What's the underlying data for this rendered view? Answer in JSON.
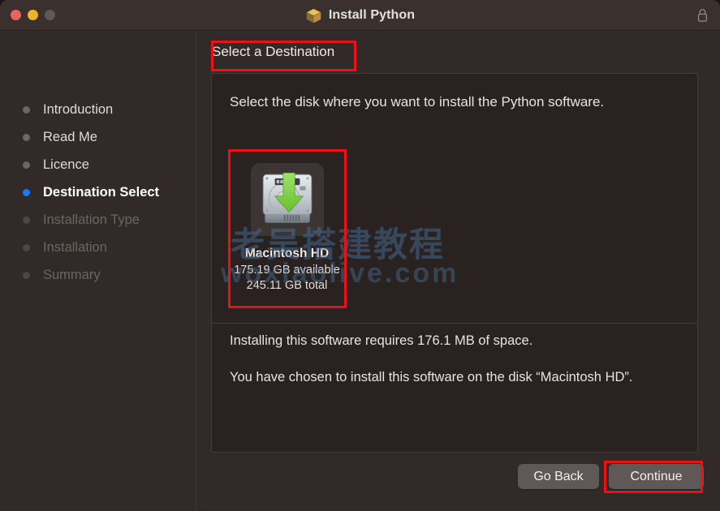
{
  "window": {
    "title": "Install Python",
    "package_icon": "package-box-icon",
    "lock_icon": "lock-icon",
    "traffic_lights": {
      "close": "close-button",
      "minimize": "minimize-button",
      "zoom": "zoom-button"
    },
    "colors": {
      "window_background": "#322A28",
      "titlebar_background": "#3A312E",
      "panel_background": "#2A2220",
      "accent_current_step": "#157DFB",
      "annotation_red": "#EE1111",
      "button_background": "#605856"
    }
  },
  "sidebar": {
    "items": [
      {
        "label": "Introduction",
        "state": "done"
      },
      {
        "label": "Read Me",
        "state": "done"
      },
      {
        "label": "Licence",
        "state": "done"
      },
      {
        "label": "Destination Select",
        "state": "current"
      },
      {
        "label": "Installation Type",
        "state": "future"
      },
      {
        "label": "Installation",
        "state": "future"
      },
      {
        "label": "Summary",
        "state": "future"
      }
    ]
  },
  "main": {
    "heading": "Select a Destination",
    "instruction": "Select the disk where you want to install the Python software.",
    "disks": [
      {
        "name": "Macintosh HD",
        "available": "175.19 GB available",
        "total": "245.11 GB total",
        "icon": "hard-drive-with-green-download-arrow-icon",
        "selected": true
      }
    ],
    "space_required": "Installing this software requires 176.1 MB of space.",
    "chosen_disk_message": "You have chosen to install this software on the disk “Macintosh HD”."
  },
  "buttons": {
    "go_back": "Go Back",
    "continue": "Continue"
  },
  "watermark": {
    "line1": "老吴搭建教程",
    "line2": "woxiaolive.com"
  }
}
